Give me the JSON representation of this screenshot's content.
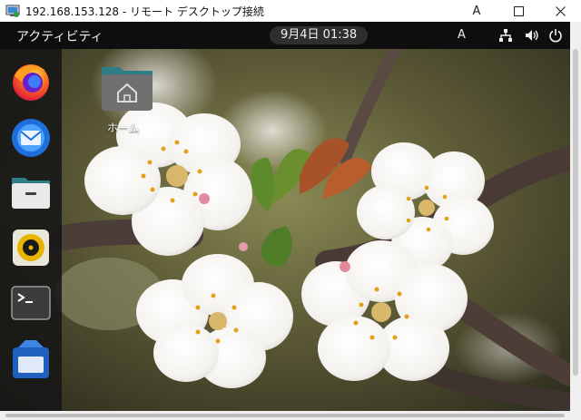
{
  "window": {
    "title": "192.168.153.128 - リモート デスクトップ接続",
    "minimize_label": "A",
    "controls": [
      "minimize-icon",
      "maximize-icon",
      "close-icon"
    ]
  },
  "topbar": {
    "activities": "アクティビティ",
    "clock": "9月4日  01:38",
    "input_method": "A",
    "tray_icons": [
      "network-icon",
      "volume-icon",
      "power-icon"
    ]
  },
  "dock": {
    "items": [
      "firefox-icon",
      "thunderbird-icon",
      "files-icon",
      "rhythmbox-icon",
      "terminal-icon",
      "software-icon"
    ]
  },
  "desktop": {
    "home_label": "ホーム"
  },
  "colors": {
    "topbar_bg": "#0e0e0e",
    "dock_bg": "#161616",
    "folder_teal": "#2f7d86"
  }
}
